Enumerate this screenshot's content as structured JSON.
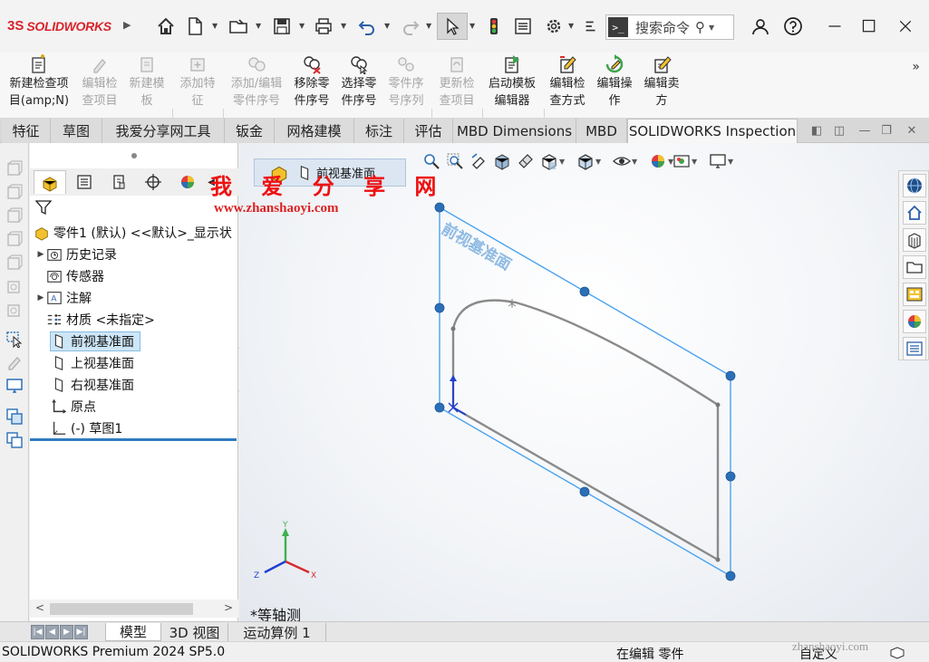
{
  "app": {
    "brand_prefix": "3S",
    "brand_name": "SOLIDWORKS"
  },
  "search": {
    "placeholder": "搜索命令"
  },
  "command_manager": {
    "buttons": [
      {
        "label": "新建检查项\n目(amp;N)",
        "enabled": true
      },
      {
        "label": "编辑检\n查项目",
        "enabled": false
      },
      {
        "label": "新建模\n板",
        "enabled": false
      },
      {
        "label": "添加特\n征",
        "enabled": false
      },
      {
        "label": "添加/编辑\n零件序号",
        "enabled": false
      },
      {
        "label": "移除零\n件序号",
        "enabled": true
      },
      {
        "label": "选择零\n件序号",
        "enabled": true
      },
      {
        "label": "零件序\n号序列",
        "enabled": false
      },
      {
        "label": "更新检\n查项目",
        "enabled": false
      },
      {
        "label": "启动模板\n编辑器",
        "enabled": true
      },
      {
        "label": "编辑检\n查方式",
        "enabled": true
      },
      {
        "label": "编辑操\n作",
        "enabled": true
      },
      {
        "label": "编辑卖\n方",
        "enabled": true
      }
    ]
  },
  "tabs": [
    "特征",
    "草图",
    "我爱分享网工具",
    "钣金",
    "网格建模",
    "标注",
    "评估",
    "MBD Dimensions",
    "MBD",
    "SOLIDWORKS Inspection"
  ],
  "active_tab": "SOLIDWORKS Inspection",
  "feature_tree": {
    "root": "零件1 (默认) <<默认>_显示状",
    "items": [
      {
        "label": "历史记录",
        "expandable": true,
        "icon": "history-folder-icon"
      },
      {
        "label": "传感器",
        "expandable": false,
        "icon": "sensor-icon"
      },
      {
        "label": "注解",
        "expandable": true,
        "icon": "annotation-icon"
      },
      {
        "label": "材质 <未指定>",
        "expandable": false,
        "icon": "material-icon"
      },
      {
        "label": "前视基准面",
        "expandable": false,
        "icon": "plane-icon",
        "selected": true
      },
      {
        "label": "上视基准面",
        "expandable": false,
        "icon": "plane-icon"
      },
      {
        "label": "右视基准面",
        "expandable": false,
        "icon": "plane-icon"
      },
      {
        "label": "原点",
        "expandable": false,
        "icon": "origin-icon"
      },
      {
        "label": "(-) 草图1",
        "expandable": false,
        "icon": "sketch-icon"
      }
    ]
  },
  "viewport": {
    "breadcrumb": "前视基准面",
    "plane_label": "前视基准面",
    "view_name": "*等轴测",
    "axes": {
      "x": "X",
      "y": "Y",
      "z": "Z"
    }
  },
  "watermark": {
    "title": "我 爱 分 享 网",
    "url": "www.zhanshaoyi.com",
    "corner": "zhanshaoyi.com"
  },
  "bottom_tabs": [
    "模型",
    "3D 视图",
    "运动算例 1"
  ],
  "active_bottom_tab": "模型",
  "status": {
    "product": "SOLIDWORKS Premium 2024 SP5.0",
    "state": "在编辑 零件",
    "units": "自定义"
  },
  "colors": {
    "brand_red": "#d8232a",
    "selection_blue": "#cde6f7",
    "plane_blue": "#4aa3f0",
    "sketch_gray": "#8a8a8a",
    "handle_blue": "#2b6fb6"
  }
}
